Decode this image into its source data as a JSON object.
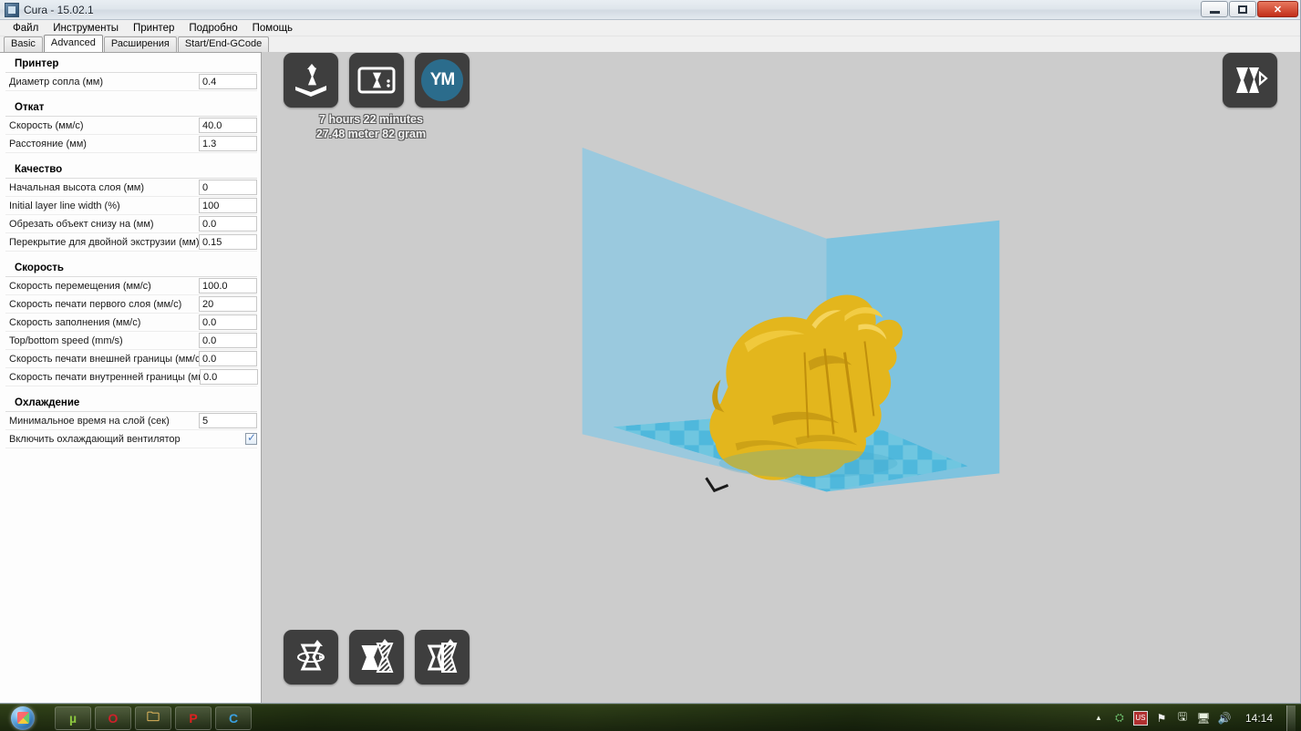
{
  "window": {
    "title": "Cura - 15.02.1",
    "app_icon": "cura-icon",
    "minimize_label": "Minimize",
    "maximize_label": "Maximize",
    "close_label": "✕"
  },
  "menubar": {
    "items": [
      {
        "label": "Файл",
        "name": "menu-file"
      },
      {
        "label": "Инструменты",
        "name": "menu-tools"
      },
      {
        "label": "Принтер",
        "name": "menu-printer"
      },
      {
        "label": "Подробно",
        "name": "menu-expert"
      },
      {
        "label": "Помощь",
        "name": "menu-help"
      }
    ]
  },
  "tabs": [
    {
      "label": "Basic",
      "active": false
    },
    {
      "label": "Advanced",
      "active": true
    },
    {
      "label": "Расширения",
      "active": false
    },
    {
      "label": "Start/End-GCode",
      "active": false
    }
  ],
  "settings": {
    "sections": [
      {
        "title": "Принтер",
        "rows": [
          {
            "label": "Диаметр сопла (мм)",
            "value": "0.4",
            "type": "text"
          }
        ]
      },
      {
        "title": "Откат",
        "rows": [
          {
            "label": "Скорость (мм/с)",
            "value": "40.0",
            "type": "text"
          },
          {
            "label": "Расстояние (мм)",
            "value": "1.3",
            "type": "text"
          }
        ]
      },
      {
        "title": "Качество",
        "rows": [
          {
            "label": "Начальная высота слоя (мм)",
            "value": "0",
            "type": "text"
          },
          {
            "label": "Initial layer line width (%)",
            "value": "100",
            "type": "text"
          },
          {
            "label": "Обрезать объект снизу на (мм)",
            "value": "0.0",
            "type": "text"
          },
          {
            "label": "Перекрытие для двойной экструзии (мм)",
            "value": "0.15",
            "type": "text"
          }
        ]
      },
      {
        "title": "Скорость",
        "rows": [
          {
            "label": "Скорость перемещения (мм/с)",
            "value": "100.0",
            "type": "text"
          },
          {
            "label": "Скорость печати первого слоя (мм/с)",
            "value": "20",
            "type": "text"
          },
          {
            "label": "Скорость заполнения (мм/с)",
            "value": "0.0",
            "type": "text"
          },
          {
            "label": "Top/bottom speed (mm/s)",
            "value": "0.0",
            "type": "text"
          },
          {
            "label": "Скорость печати внешней границы (мм/с)",
            "value": "0.0",
            "type": "text"
          },
          {
            "label": "Скорость печати внутренней границы (мм/с)",
            "value": "0.0",
            "type": "text"
          }
        ]
      },
      {
        "title": "Охлаждение",
        "rows": [
          {
            "label": "Минимальное время на слой (сек)",
            "value": "5",
            "type": "text"
          },
          {
            "label": "Включить охлаждающий вентилятор",
            "value": "",
            "type": "checkbox",
            "checked": true
          }
        ]
      }
    ]
  },
  "viewport": {
    "background_color": "#cccccc",
    "toolbar_top": [
      {
        "name": "load-model-button",
        "icon": "load-model-icon",
        "label": "Load model"
      },
      {
        "name": "save-toolpath-button",
        "icon": "save-toolpath-icon",
        "label": "Save toolpath"
      },
      {
        "name": "youmagine-button",
        "icon": "youmagine-icon",
        "label": "YM"
      }
    ],
    "toolbar_bottom": [
      {
        "name": "rotate-button",
        "icon": "rotate-icon",
        "label": "Rotate"
      },
      {
        "name": "scale-button",
        "icon": "scale-icon",
        "label": "Scale"
      },
      {
        "name": "mirror-button",
        "icon": "mirror-icon",
        "label": "Mirror"
      }
    ],
    "view_mode_button": {
      "name": "view-mode-button",
      "icon": "view-mode-icon",
      "label": "View mode"
    },
    "print_stats": {
      "time": "7 hours 22 minutes",
      "material": "27.48 meter 82 gram"
    },
    "build_volume": {
      "wall_left_color": "#9ac9de",
      "wall_right_color": "#7ec3df",
      "floor_light_color": "#6fc6e0",
      "floor_dark_color": "#4fb8dc",
      "model_color": "#e3b61d"
    }
  },
  "taskbar": {
    "start_label": "Start",
    "apps": [
      {
        "name": "taskbar-utorrent",
        "glyph": "µ",
        "color": "#8cc63f"
      },
      {
        "name": "taskbar-opera",
        "glyph": "O",
        "color": "#d0202a"
      },
      {
        "name": "taskbar-explorer",
        "glyph": "🗀",
        "color": "#f0c060"
      },
      {
        "name": "taskbar-punto",
        "glyph": "P",
        "color": "#e02020"
      },
      {
        "name": "taskbar-cura",
        "glyph": "C",
        "color": "#3aa0e0"
      }
    ],
    "tray": [
      {
        "name": "tray-show-hidden-icon",
        "glyph": "▲"
      },
      {
        "name": "tray-network-sync-icon",
        "glyph": "⛭"
      },
      {
        "name": "tray-language-icon",
        "glyph": "US"
      },
      {
        "name": "tray-action-center-icon",
        "glyph": "⚑"
      },
      {
        "name": "tray-removable-media-icon",
        "glyph": "🖫"
      },
      {
        "name": "tray-network-icon",
        "glyph": "🖥"
      },
      {
        "name": "tray-volume-icon",
        "glyph": "🔊"
      }
    ],
    "clock": "14:14"
  }
}
